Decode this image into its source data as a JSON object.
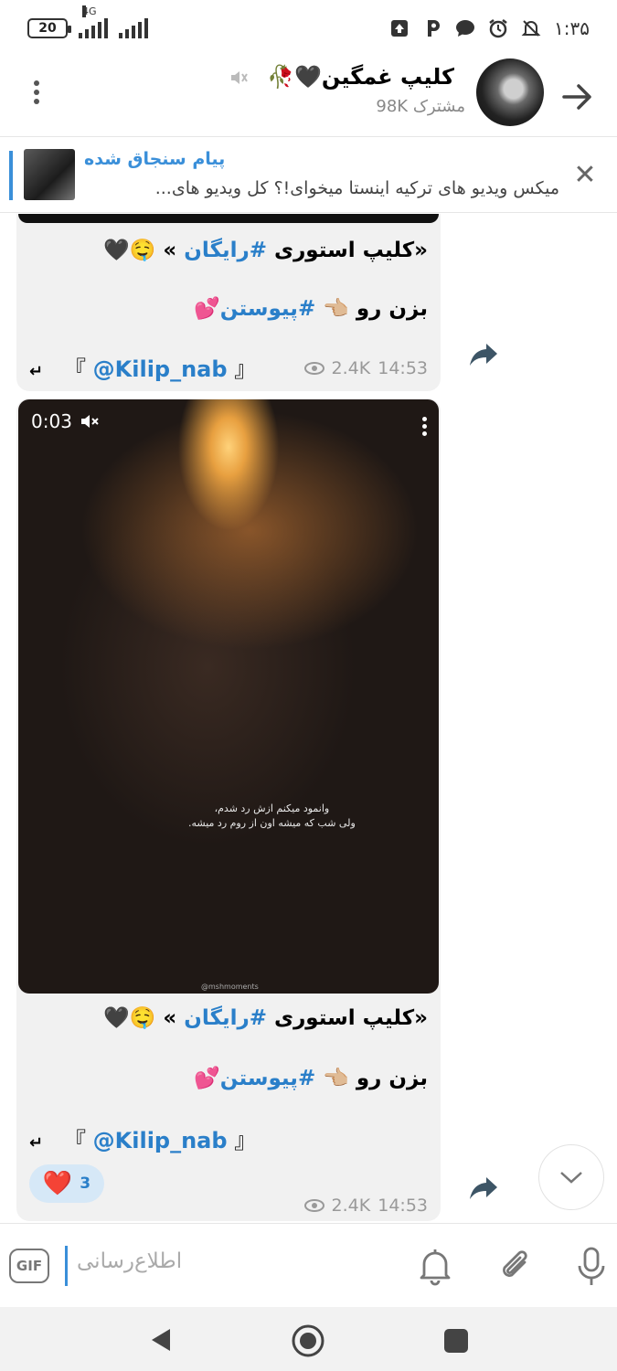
{
  "status_bar": {
    "battery": "20",
    "network": "4G",
    "time": "۱:۳۵"
  },
  "header": {
    "title": "کلیپ غمگین🖤🥀",
    "subscribers": "مشترک 98K"
  },
  "pinned": {
    "title": "پیام سنجاق شده",
    "text": "میکس ویدیو های ترکیه اینستا میخوای!؟  کل ویدیو های...",
    "close_symbol": "✕"
  },
  "messages": [
    {
      "line1_pre": "«کلیپ استوری ",
      "line1_tag": "#رایگان",
      "line1_post": " » 🤤🖤",
      "line2_pre": "بزن رو 👈🏼 ",
      "line2_tag": "#پیوستن",
      "line2_post": "💕",
      "signature_open": "『 ",
      "signature_handle": "@Kilip_nab",
      "signature_close": " 』",
      "reply_glyph": "↵",
      "views": "2.4K",
      "time": "14:53"
    },
    {
      "video_duration": "0:03",
      "video_caption_line1": "وانمود میکنم ازش رد شدم،",
      "video_caption_line2": "ولی شب که میشه اون از روم رد میشه.",
      "video_watermark": "@mshmoments",
      "line1_pre": "«کلیپ استوری ",
      "line1_tag": "#رایگان",
      "line1_post": " » 🤤🖤",
      "line2_pre": "بزن رو 👈🏼 ",
      "line2_tag": "#پیوستن",
      "line2_post": "💕",
      "signature_open": "『 ",
      "signature_handle": "@Kilip_nab",
      "signature_close": " 』",
      "reply_glyph": "↵",
      "reaction_emoji": "❤️",
      "reaction_count": "3",
      "views": "2.4K",
      "time": "14:53"
    }
  ],
  "input": {
    "placeholder": "اطلاع‌رسانی",
    "gif_label": "GIF"
  },
  "colors": {
    "accent": "#3a8fd9",
    "link": "#2a7fc9",
    "bubble": "#f1f1f1",
    "reaction_bg": "#d6e8f7"
  }
}
